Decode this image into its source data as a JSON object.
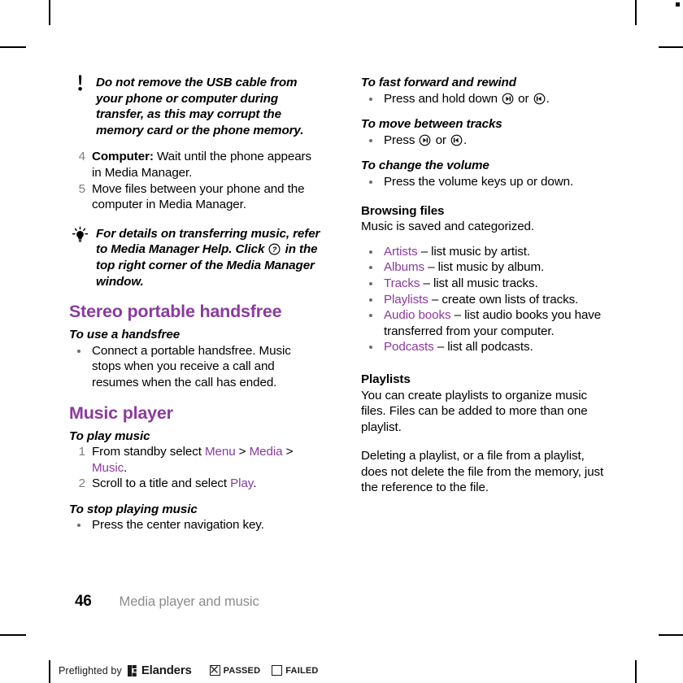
{
  "document": {
    "page_number": "46",
    "chapter_title": "Media player and music"
  },
  "left_column": {
    "warning_note": {
      "icon": "exclamation-icon",
      "text": "Do not remove the USB cable from your phone or computer during transfer, as this may corrupt the memory card or the phone memory."
    },
    "steps": [
      {
        "num": "4",
        "lead": "Computer:",
        "text": " Wait until the phone appears in Media Manager."
      },
      {
        "num": "5",
        "lead": "",
        "text": "Move files between your phone and the computer in Media Manager."
      }
    ],
    "tip_note": {
      "icon": "lightbulb-icon",
      "text_before": "For details on transferring music, refer to Media Manager Help. Click ",
      "inline_icon": "question-mark-icon",
      "text_after": " in the top right corner of the Media Manager window."
    },
    "handsfree_section": {
      "heading": "Stereo portable handsfree",
      "subheading": "To use a handsfree",
      "bullet": "Connect a portable handsfree. Music stops when you receive a call and resumes when the call has ended."
    },
    "music_player_section": {
      "heading": "Music player",
      "play_music": {
        "subheading": "To play music",
        "steps": [
          {
            "num": "1",
            "prefix": "From standby select ",
            "menu1": "Menu",
            "sep1": " > ",
            "menu2": "Media",
            "sep2": " > ",
            "menu3": "Music",
            "suffix": "."
          },
          {
            "num": "2",
            "prefix": "Scroll to a title and select ",
            "menu1": "Play",
            "suffix": "."
          }
        ]
      },
      "stop_music": {
        "subheading": "To stop playing music",
        "bullet": "Press the center navigation key."
      }
    }
  },
  "right_column": {
    "fast_forward": {
      "subheading": "To fast forward and rewind",
      "text_before": "Press and hold down ",
      "icon_right": "nav-key-right-icon",
      "text_middle": " or ",
      "icon_left": "nav-key-left-icon",
      "text_after": "."
    },
    "move_tracks": {
      "subheading": "To move between tracks",
      "text_before": "Press ",
      "icon_right": "nav-key-right-icon",
      "text_middle": " or ",
      "icon_left": "nav-key-left-icon",
      "text_after": "."
    },
    "change_volume": {
      "subheading": "To change the volume",
      "bullet": "Press the volume keys up or down."
    },
    "browsing_files": {
      "heading": "Browsing files",
      "intro": "Music is saved and categorized.",
      "items": [
        {
          "term": "Artists",
          "desc": " – list music by artist."
        },
        {
          "term": "Albums",
          "desc": " – list music by album."
        },
        {
          "term": "Tracks",
          "desc": " – list all music tracks."
        },
        {
          "term": "Playlists",
          "desc": " – create own lists of tracks."
        },
        {
          "term": "Audio books",
          "desc": " – list audio books you have transferred from your computer."
        },
        {
          "term": "Podcasts",
          "desc": " – list all podcasts."
        }
      ]
    },
    "playlists_section": {
      "heading": "Playlists",
      "paragraph1": "You can create playlists to organize music files. Files can be added to more than one playlist.",
      "paragraph2": "Deleting a playlist, or a file from a playlist, does not delete the file from the memory, just the reference to the file."
    }
  },
  "preflight_bar": {
    "text": "Preflighted by",
    "brand": "Elanders",
    "passed_label": "PASSED",
    "failed_label": "FAILED",
    "passed_checked": "checked",
    "failed_checked": "unchecked"
  },
  "colors": {
    "accent_purple": "#8B3A9E",
    "muted_grey": "#8c8c8c",
    "number_grey": "#808080"
  }
}
